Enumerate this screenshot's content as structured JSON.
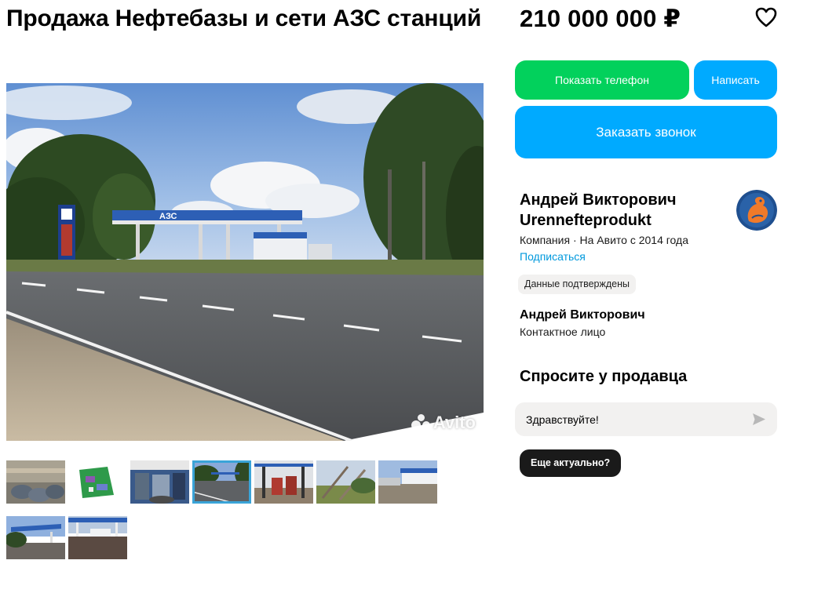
{
  "listing": {
    "title": "Продажа Нефтебазы и сети АЗС станций",
    "price": "210 000 000 ₽",
    "favorite_icon": "heart-icon",
    "photo_watermark": "Avito",
    "photo_sign_text": "АЗС",
    "thumbnail_count": 9,
    "active_thumbnail": 4
  },
  "actions": {
    "show_phone": "Показать телефон",
    "write": "Написать",
    "order_call": "Заказать звонок"
  },
  "seller": {
    "name": "Андрей Викторович Urennefteprodukt",
    "meta": "Компания · На Авито с 2014 года",
    "subscribe": "Подписаться",
    "verified_badge": "Данные подтверждены",
    "avatar_icon": "squirrel-logo-icon",
    "contact_name": "Андрей Викторович",
    "contact_role": "Контактное лицо"
  },
  "ask": {
    "title": "Спросите у продавца",
    "input_value": "Здравствуйте!",
    "send_icon": "send-icon",
    "quick_reply": "Еще актуально?"
  },
  "colors": {
    "green": "#02d15c",
    "blue": "#00aaff",
    "link": "#0099dd",
    "dark": "#1a1a1a",
    "badge_bg": "#f2f1f0"
  }
}
